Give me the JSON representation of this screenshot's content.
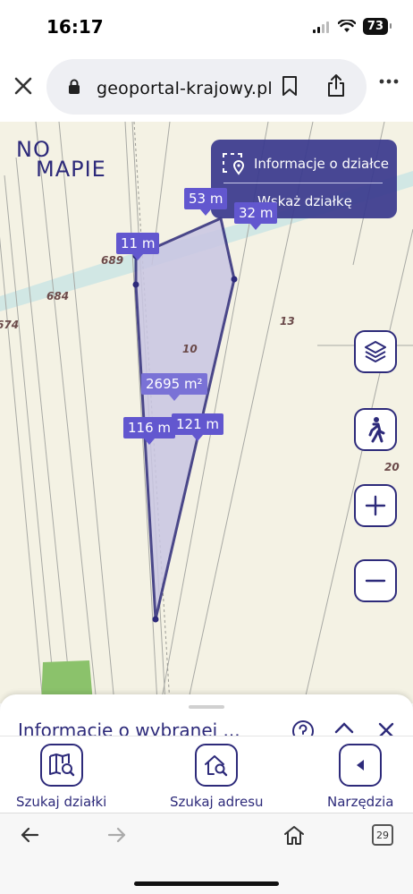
{
  "status": {
    "time": "16:17",
    "battery": "73"
  },
  "browser": {
    "url": "geoportal-krajowy.pl"
  },
  "logo": {
    "line1": "NO",
    "line2": "MAPIE"
  },
  "info_panel": {
    "title": "Informacje o działce",
    "action": "Wskaż działkę"
  },
  "measurements": {
    "top1": "53 m",
    "top2": "32 m",
    "left_top": "11 m",
    "area": "2695 m²",
    "left": "116 m",
    "right": "121 m"
  },
  "plot_numbers": {
    "p689": "689",
    "p684": "684",
    "p674": "674",
    "p13": "13",
    "p10": "10",
    "p20": "20"
  },
  "sheet": {
    "title": "Informacje o wybranej ..."
  },
  "toolbar": {
    "parcel": "Szukaj działki",
    "address": "Szukaj adresu",
    "tools": "Narzędzia"
  },
  "nav": {
    "tabs_count": "29"
  },
  "colors": {
    "brand": "#2d2a7a",
    "accent": "#6257cf",
    "polygon_fill": "#c9c6e3"
  }
}
